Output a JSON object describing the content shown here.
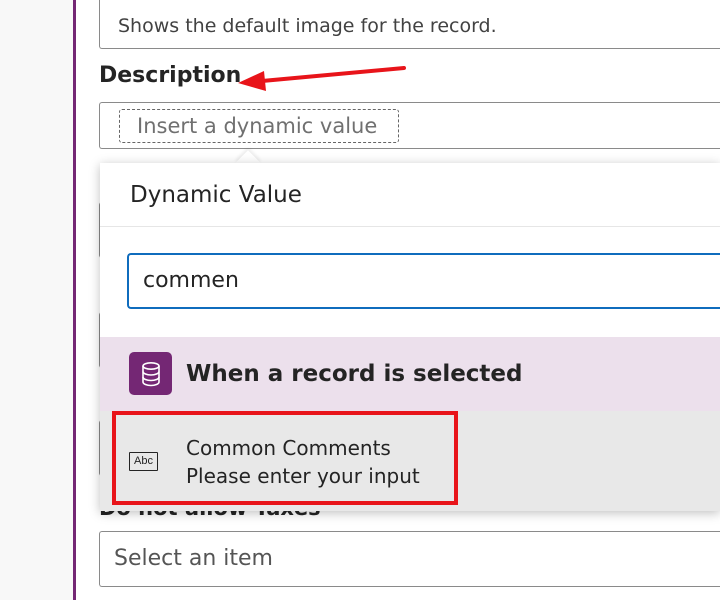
{
  "image_field": {
    "value": "Shows the default image for the record."
  },
  "description": {
    "label": "Description",
    "chip_placeholder": "Insert a dynamic value"
  },
  "dynamic_value_popup": {
    "title": "Dynamic Value",
    "search_value": "commen",
    "group": {
      "title": "When a record is selected",
      "icon": "database-icon"
    },
    "results": [
      {
        "icon": "abc-text-icon",
        "icon_text": "Abc",
        "name": "Common Comments",
        "description": "Please enter your input"
      }
    ]
  },
  "taxes": {
    "label": "Do not allow Taxes",
    "select_placeholder": "Select an item"
  },
  "colors": {
    "accent_purple": "#742774",
    "focus_blue": "#0f6cbd",
    "group_bg": "#ece0ec",
    "annotation_red": "#e8141a"
  }
}
